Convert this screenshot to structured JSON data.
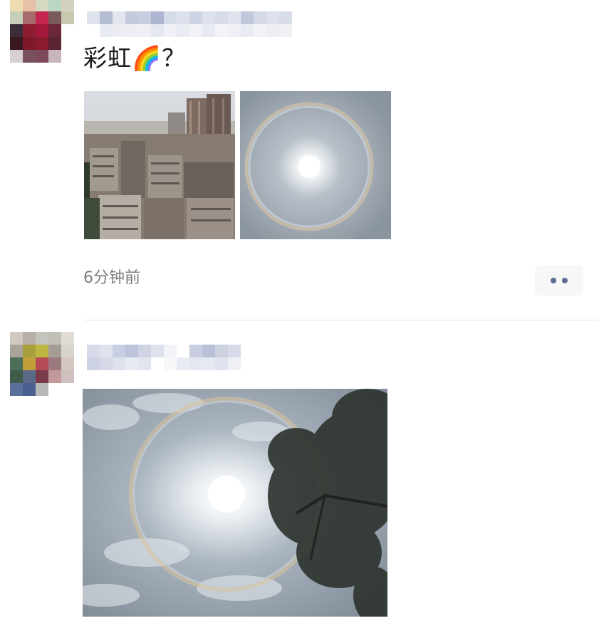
{
  "posts": [
    {
      "text": "彩虹🌈？",
      "time": "6分钟前",
      "photos": [
        "city-buildings-photo",
        "sun-halo-photo"
      ]
    },
    {
      "photos": [
        "sun-halo-tree-photo"
      ]
    }
  ],
  "colors": {
    "timestamp": "#7d7d7d",
    "more_dots": "#5b6b93",
    "divider": "#e3e3e3"
  }
}
